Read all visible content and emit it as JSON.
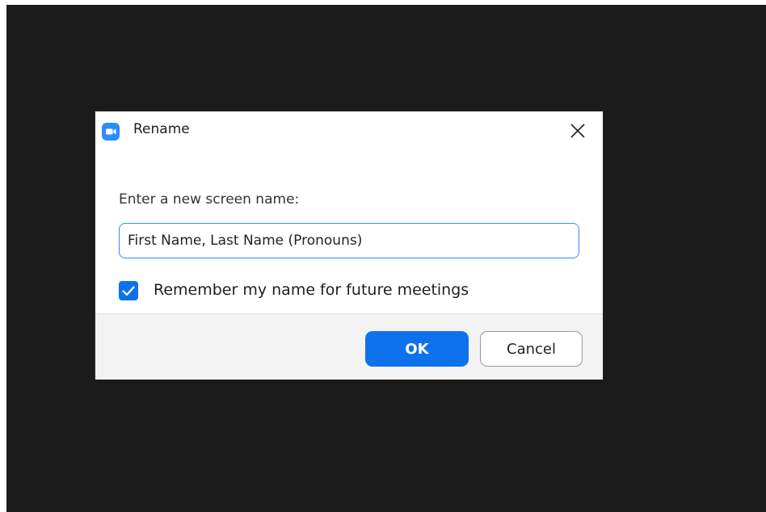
{
  "dialog": {
    "title": "Rename",
    "app_icon": "zoom-video-icon",
    "close_icon": "close-icon",
    "prompt": "Enter a new screen name:",
    "name_input": {
      "value": "First Name, Last Name (Pronouns)"
    },
    "remember": {
      "label": "Remember my name for future meetings",
      "checked": true
    },
    "ok_label": "OK",
    "cancel_label": "Cancel"
  },
  "colors": {
    "backdrop": "#1b1b1b",
    "accent": "#0e72ed",
    "app_icon": "#2d8cff",
    "footer": "#f3f3f3"
  }
}
